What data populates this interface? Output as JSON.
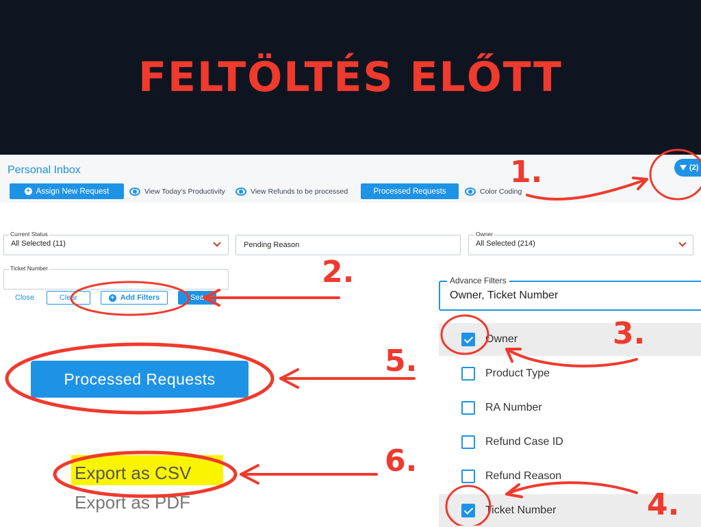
{
  "banner": {
    "title": "FELTÖLTÉS ELŐTT"
  },
  "header": {
    "title": "Personal Inbox",
    "assign_label": "Assign New Request",
    "view_productivity": "View Today's Productivity",
    "view_refunds": "View Refunds to be processed",
    "processed_label": "Processed Requests",
    "color_coding": "Color Coding",
    "filter_count": "(2)"
  },
  "filters": {
    "current_status": {
      "label": "Current Status",
      "value": "All Selected (11)"
    },
    "pending_reason": {
      "value": "Pending Reason"
    },
    "owner": {
      "label": "Owner",
      "value": "All Selected (214)"
    },
    "ticket_number": {
      "label": "Ticket Number",
      "value": ""
    },
    "close_label": "Close",
    "clear_label": "Clear",
    "add_filters_label": "Add Filters",
    "search_label": "Sea"
  },
  "advance": {
    "label": "Advance Filters",
    "value": "Owner, Ticket Number",
    "options": [
      {
        "label": "Owner",
        "checked": true
      },
      {
        "label": "Product Type",
        "checked": false
      },
      {
        "label": "RA Number",
        "checked": false
      },
      {
        "label": "Refund Case ID",
        "checked": false
      },
      {
        "label": "Refund Reason",
        "checked": false
      },
      {
        "label": "Ticket Number",
        "checked": true
      }
    ]
  },
  "zoom": {
    "processed_label": "Processed Requests",
    "export_csv": "Export as CSV",
    "export_pdf": "Export as PDF"
  },
  "steps": [
    "1.",
    "2.",
    "3.",
    "4.",
    "5.",
    "6."
  ],
  "colors": {
    "accent": "#1e93e6",
    "annotation": "#ef3a2d",
    "banner": "#0f1421",
    "highlight": "#fbf400"
  }
}
